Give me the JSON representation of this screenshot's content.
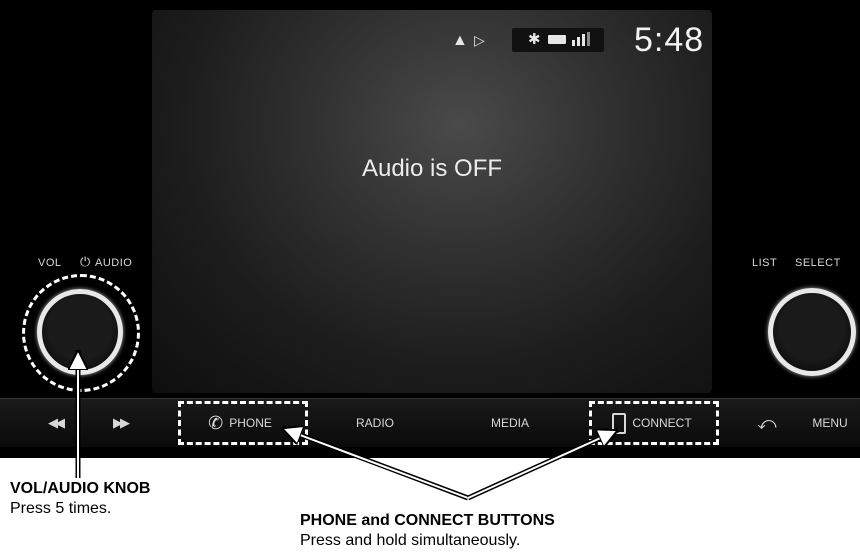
{
  "screen": {
    "clock": "5:48",
    "message": "Audio is OFF"
  },
  "knob_labels": {
    "vol": "VOL",
    "audio": "AUDIO",
    "list": "LIST",
    "select": "SELECT"
  },
  "buttons": {
    "phone": "PHONE",
    "radio": "RADIO",
    "media": "MEDIA",
    "connect": "CONNECT",
    "menu": "MENU"
  },
  "callouts": {
    "knob_title": "VOL/AUDIO KNOB",
    "knob_text": "Press 5 times.",
    "buttons_title": "PHONE and CONNECT BUTTONS",
    "buttons_text": "Press and hold simultaneously."
  },
  "icons": {
    "nav": "navigation-icon",
    "media_status": "play-circle-icon",
    "bluetooth": "bluetooth-icon",
    "battery": "battery-icon",
    "signal": "signal-icon",
    "power": "power-icon",
    "prev": "previous-track-icon",
    "next": "next-track-icon",
    "phone": "phone-icon",
    "connect": "smartphone-icon",
    "back": "back-icon"
  }
}
